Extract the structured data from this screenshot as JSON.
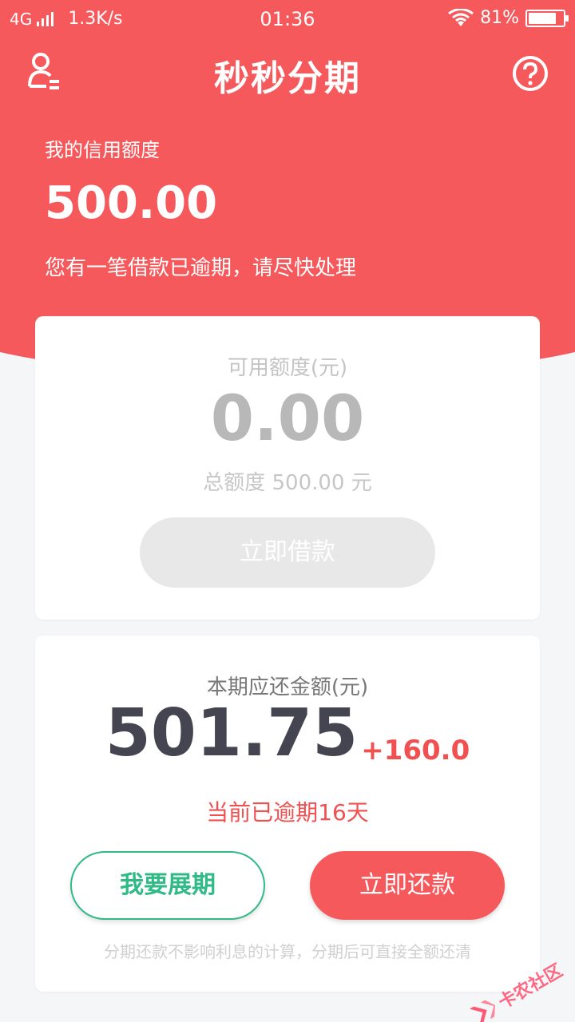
{
  "status_bar": {
    "network": "4G",
    "speed": "1.3K/s",
    "time": "01:36",
    "battery": "81%",
    "battery_level": 0.81
  },
  "nav": {
    "title": "秒秒分期",
    "user_icon": "user-icon",
    "help_icon": "help-circle-icon"
  },
  "credit": {
    "label": "我的信用额度",
    "value": "500.00",
    "notice": "您有一笔借款已逾期，请尽快处理"
  },
  "available": {
    "label": "可用额度(元)",
    "value": "0.00",
    "total": "总额度 500.00 元",
    "button": "立即借款"
  },
  "repayment": {
    "label": "本期应还金额(元)",
    "amount": "501.75",
    "extra": "+160.0",
    "overdue": "当前已逾期16天",
    "extend_button": "我要展期",
    "repay_button": "立即还款",
    "footnote": "分期还款不影响利息的计算，分期后可直接全额还清"
  },
  "watermark": {
    "text": "卡农社区"
  },
  "colors": {
    "brand_red": "#f5595b",
    "green": "#2fba86",
    "dark_text": "#454552"
  }
}
